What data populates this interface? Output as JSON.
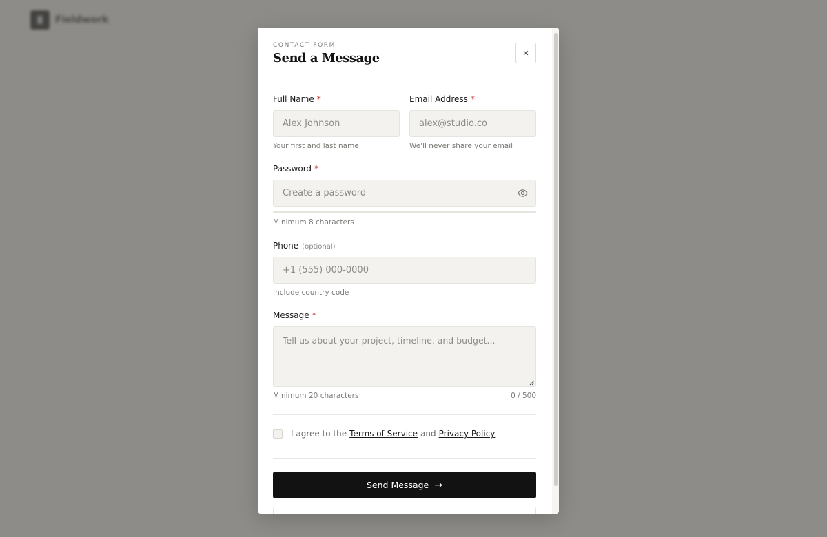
{
  "background": {
    "brand_name": "Fieldwork"
  },
  "modal": {
    "eyebrow": "CONTACT FORM",
    "title": "Send a Message",
    "close_label": "×"
  },
  "form": {
    "full_name": {
      "label": "Full Name",
      "required_mark": "*",
      "placeholder": "Alex Johnson",
      "value": "",
      "help": "Your first and last name"
    },
    "email": {
      "label": "Email Address",
      "required_mark": "*",
      "placeholder": "alex@studio.co",
      "value": "",
      "help": "We'll never share your email"
    },
    "password": {
      "label": "Password",
      "required_mark": "*",
      "placeholder": "Create a password",
      "value": "",
      "help": "Minimum 8 characters",
      "toggle_icon": "eye-icon"
    },
    "phone": {
      "label": "Phone",
      "optional_tag": "(optional)",
      "placeholder": "+1 (555) 000-0000",
      "value": "",
      "help": "Include country code"
    },
    "message": {
      "label": "Message",
      "required_mark": "*",
      "placeholder": "Tell us about your project, timeline, and budget...",
      "value": "",
      "help": "Minimum 20 characters",
      "counter": "0 / 500"
    },
    "agree": {
      "prefix": "I agree to the",
      "terms_link": "Terms of Service",
      "joiner": "and",
      "privacy_link": "Privacy Policy",
      "checked": false
    },
    "submit": {
      "label": "Send Message",
      "arrow": "→"
    }
  },
  "colors": {
    "overlay": "#8d8c88",
    "accent_required": "#c0392b",
    "button_bg": "#121212",
    "input_bg": "#f3f2ee"
  }
}
